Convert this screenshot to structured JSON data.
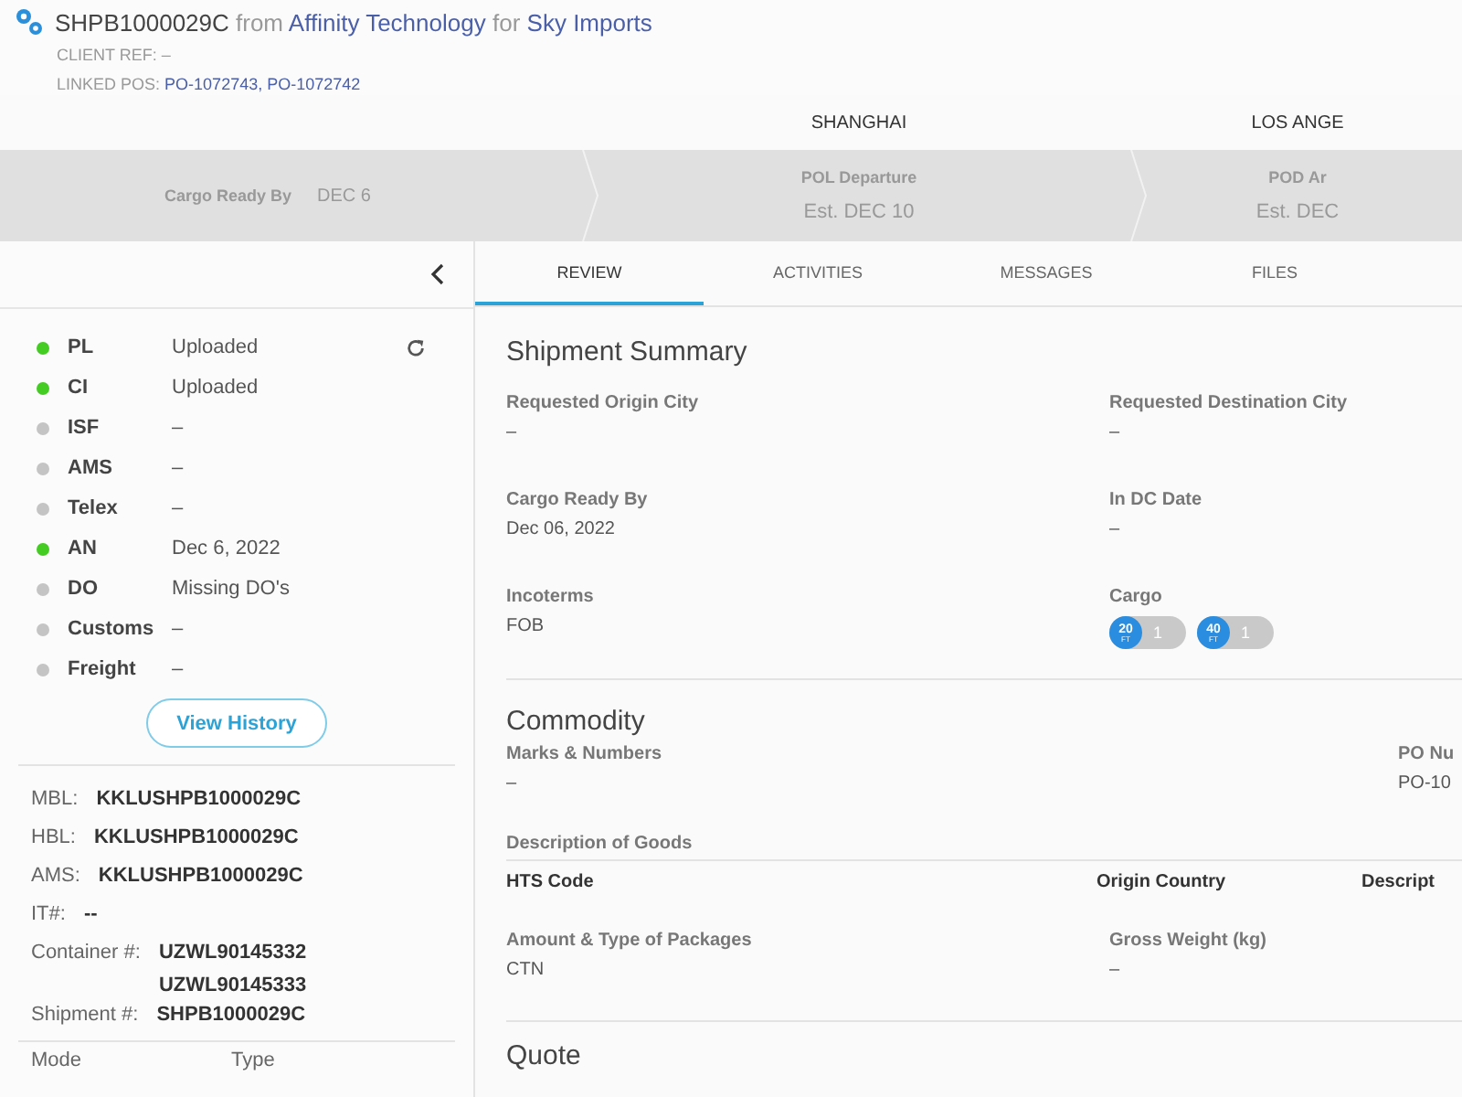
{
  "header": {
    "shipment_id": "SHPB1000029C",
    "from_word": "from",
    "origin": "Affinity Technology",
    "for_word": "for",
    "customer": "Sky Imports",
    "client_ref_label": "CLIENT REF:",
    "client_ref": "–",
    "linked_pos_label": "LINKED POS:",
    "linked_pos": "PO-1072743, PO-1072742"
  },
  "timeline": {
    "cities": [
      "SHANGHAI",
      "LOS ANGE"
    ],
    "steps": [
      {
        "kind": "inline",
        "label": "Cargo Ready By",
        "value": "DEC 6"
      },
      {
        "kind": "stacked",
        "label": "POL Departure",
        "value": "Est. DEC 10"
      },
      {
        "kind": "stacked",
        "label": "POD Ar",
        "value": "Est. DEC"
      }
    ]
  },
  "sidebar": {
    "documents": [
      {
        "name": "PL",
        "status": "Uploaded",
        "color": "#44cc22"
      },
      {
        "name": "CI",
        "status": "Uploaded",
        "color": "#44cc22"
      },
      {
        "name": "ISF",
        "status": "–",
        "color": "#c4c4c4"
      },
      {
        "name": "AMS",
        "status": "–",
        "color": "#c4c4c4"
      },
      {
        "name": "Telex",
        "status": "–",
        "color": "#c4c4c4"
      },
      {
        "name": "AN",
        "status": "Dec 6, 2022",
        "color": "#44cc22"
      },
      {
        "name": "DO",
        "status": "Missing DO's",
        "color": "#c4c4c4"
      },
      {
        "name": "Customs",
        "status": "–",
        "color": "#c4c4c4"
      },
      {
        "name": "Freight",
        "status": "–",
        "color": "#c4c4c4"
      }
    ],
    "history_button": "View History",
    "references": [
      {
        "label": "MBL:",
        "values": [
          "KKLUSHPB1000029C"
        ]
      },
      {
        "label": "HBL:",
        "values": [
          "KKLUSHPB1000029C"
        ]
      },
      {
        "label": "AMS:",
        "values": [
          "KKLUSHPB1000029C"
        ]
      },
      {
        "label": "IT#:",
        "values": [
          "--"
        ]
      },
      {
        "label": "Container #:",
        "values": [
          "UZWL90145332",
          "UZWL90145333"
        ]
      },
      {
        "label": "Shipment #:",
        "values": [
          "SHPB1000029C"
        ]
      }
    ],
    "table_columns": [
      "Mode",
      "Type"
    ]
  },
  "tabs": [
    {
      "label": "REVIEW",
      "selected": true
    },
    {
      "label": "ACTIVITIES",
      "selected": false
    },
    {
      "label": "MESSAGES",
      "selected": false
    },
    {
      "label": "FILES",
      "selected": false
    }
  ],
  "summary": {
    "title": "Shipment Summary",
    "fields": [
      {
        "label": "Requested Origin City",
        "value": "–"
      },
      {
        "label": "Requested Destination City",
        "value": "–"
      },
      {
        "label": "Cargo Ready By",
        "value": "Dec 06, 2022"
      },
      {
        "label": "In DC Date",
        "value": "–"
      },
      {
        "label": "Incoterms",
        "value": "FOB"
      }
    ],
    "cargo": {
      "label": "Cargo",
      "containers": [
        {
          "size": "20",
          "unit": "FT",
          "count": "1"
        },
        {
          "size": "40",
          "unit": "FT",
          "count": "1"
        }
      ]
    }
  },
  "commodity": {
    "title": "Commodity",
    "fields": [
      {
        "label": "Marks & Numbers",
        "value": "–"
      },
      {
        "label": "PO Nu",
        "value": "PO-10"
      }
    ],
    "goods_label": "Description of Goods",
    "goods_columns": [
      "HTS Code",
      "Origin Country",
      "Descript"
    ],
    "packages": [
      {
        "label": "Amount & Type of Packages",
        "value": "CTN"
      },
      {
        "label": "Gross Weight (kg)",
        "value": "–"
      }
    ]
  },
  "quote": {
    "title": "Quote"
  }
}
